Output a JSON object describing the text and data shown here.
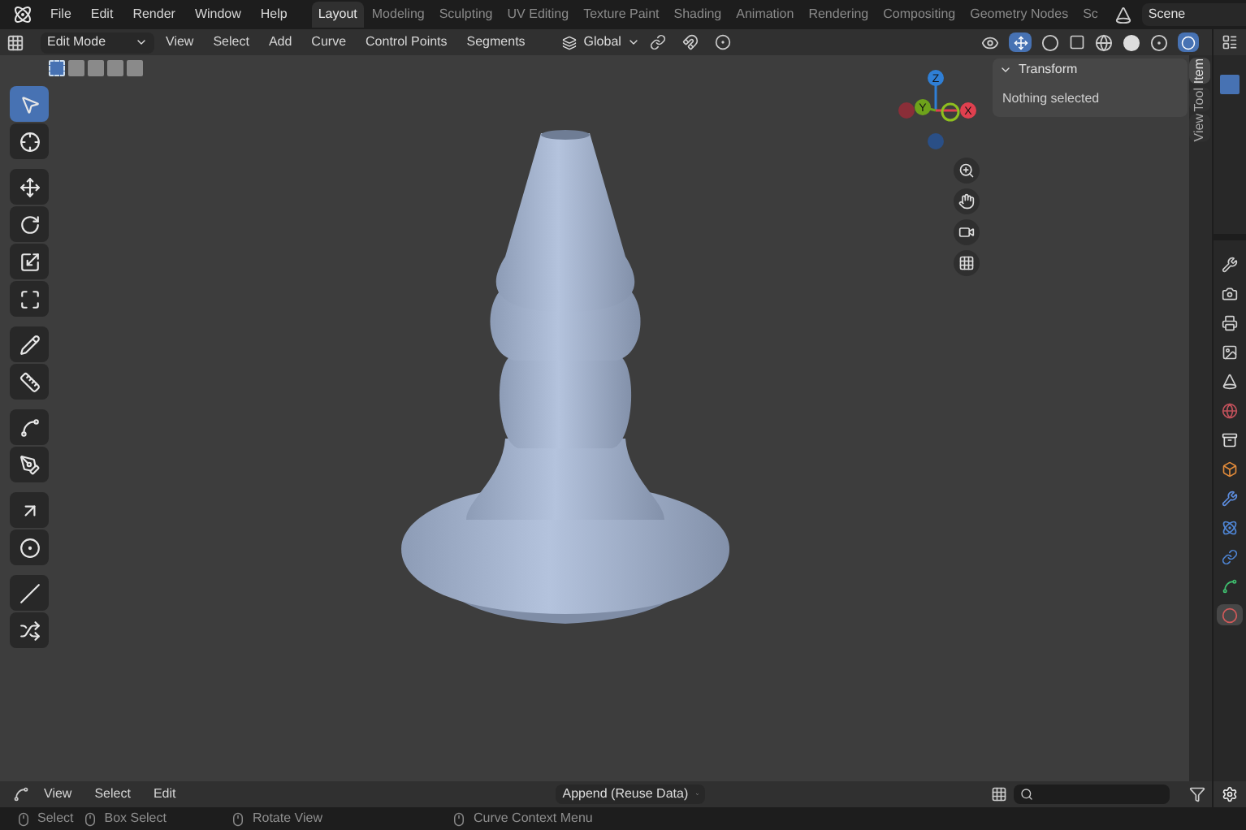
{
  "top_menu": [
    "File",
    "Edit",
    "Render",
    "Window",
    "Help"
  ],
  "workspaces": [
    {
      "label": "Layout",
      "selected": true
    },
    {
      "label": "Modeling",
      "selected": false
    },
    {
      "label": "Sculpting",
      "selected": false
    },
    {
      "label": "UV Editing",
      "selected": false
    },
    {
      "label": "Texture Paint",
      "selected": false
    },
    {
      "label": "Shading",
      "selected": false
    },
    {
      "label": "Animation",
      "selected": false
    },
    {
      "label": "Rendering",
      "selected": false
    },
    {
      "label": "Compositing",
      "selected": false
    },
    {
      "label": "Geometry Nodes",
      "selected": false
    },
    {
      "label": "Sc",
      "selected": false
    }
  ],
  "scene": "Scene",
  "header": {
    "mode": "Edit Mode",
    "menus": [
      "View",
      "Select",
      "Add",
      "Curve",
      "Control Points",
      "Segments"
    ],
    "orientation": "Global"
  },
  "select_modes": [
    {
      "selected": true
    },
    {
      "selected": false
    },
    {
      "selected": false
    },
    {
      "selected": false
    },
    {
      "selected": false
    }
  ],
  "tools": [
    {
      "kind": "select",
      "selected": true
    },
    {
      "kind": "cursor",
      "selected": false
    },
    {
      "kind": "move",
      "selected": false
    },
    {
      "kind": "rotate",
      "selected": false
    },
    {
      "kind": "scale",
      "selected": false
    },
    {
      "kind": "transform",
      "selected": false
    },
    {
      "kind": "annotate",
      "selected": false
    },
    {
      "kind": "measure",
      "selected": false
    },
    {
      "kind": "draw",
      "selected": false
    },
    {
      "kind": "pen",
      "selected": false
    },
    {
      "kind": "extrude",
      "selected": false
    },
    {
      "kind": "radius",
      "selected": false
    },
    {
      "kind": "tilt",
      "selected": false
    },
    {
      "kind": "randomize",
      "selected": false
    }
  ],
  "gizmo_axes": [
    {
      "label": "Z",
      "color": "#2f7fd6"
    },
    {
      "label": "Y",
      "color": "#6ea21b"
    },
    {
      "label": "X",
      "color": "#e0404f"
    }
  ],
  "sidebar": {
    "panel_title": "Transform",
    "expanded": true,
    "message": "Nothing selected",
    "tabs": [
      {
        "label": "Item",
        "selected": true
      },
      {
        "label": "Tool",
        "selected": false
      },
      {
        "label": "View",
        "selected": false
      }
    ]
  },
  "properties_tabs": [
    {
      "kind": "tool",
      "selected": false
    },
    {
      "kind": "render",
      "selected": false
    },
    {
      "kind": "output",
      "selected": false
    },
    {
      "kind": "view-layer",
      "selected": false
    },
    {
      "kind": "scene",
      "selected": false
    },
    {
      "kind": "world",
      "selected": false
    },
    {
      "kind": "collection",
      "selected": false
    },
    {
      "kind": "object",
      "selected": false
    },
    {
      "kind": "modifier",
      "selected": false
    },
    {
      "kind": "physics",
      "selected": false
    },
    {
      "kind": "constraint",
      "selected": false
    },
    {
      "kind": "data",
      "selected": false
    },
    {
      "kind": "material",
      "selected": true
    }
  ],
  "asset_browser": {
    "menus": [
      "View",
      "Select",
      "Edit"
    ],
    "import_method": "Append (Reuse Data)"
  },
  "status_bar": [
    "Select",
    "Box Select",
    "Rotate View",
    "Curve Context Menu"
  ]
}
